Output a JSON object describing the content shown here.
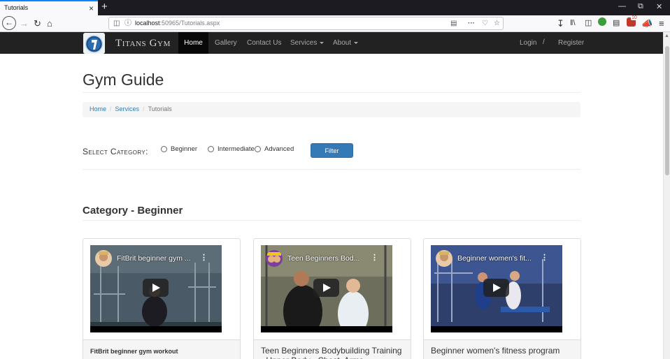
{
  "browser": {
    "tab_title": "Tutorials",
    "close_symbol": "×",
    "new_tab_symbol": "+",
    "url_host": "localhost",
    "url_path": ":50965/Tutorials.aspx",
    "notification_count": "10"
  },
  "nav": {
    "brand": "Titans Gym",
    "items": [
      "Home",
      "Gallery",
      "Contact Us",
      "Services",
      "About"
    ],
    "login": "Login",
    "separator": "/",
    "register": "Register"
  },
  "page": {
    "title": "Gym Guide",
    "breadcrumb": [
      "Home",
      "Services",
      "Tutorials"
    ],
    "breadcrumb_sep": "/",
    "category_label": "Select Category:",
    "radios": [
      "Beginner",
      "Intermediate",
      "Advanced"
    ],
    "filter_button": "Filter",
    "section_title": "Category - Beginner"
  },
  "cards": [
    {
      "video_title": "FitBrit beginner gym ...",
      "caption": "FitBrit beginner gym workout"
    },
    {
      "video_title": "Teen Beginners Bod...",
      "caption": "Teen Beginners Bodybuilding Training - Upper Body - Chest, Arms, Shoulders"
    },
    {
      "video_title": "Beginner women's fit...",
      "caption": "Beginner women's fitness program"
    }
  ],
  "colors": {
    "accent": "#337ab7",
    "navbar": "#222222",
    "active_nav": "#080808"
  }
}
